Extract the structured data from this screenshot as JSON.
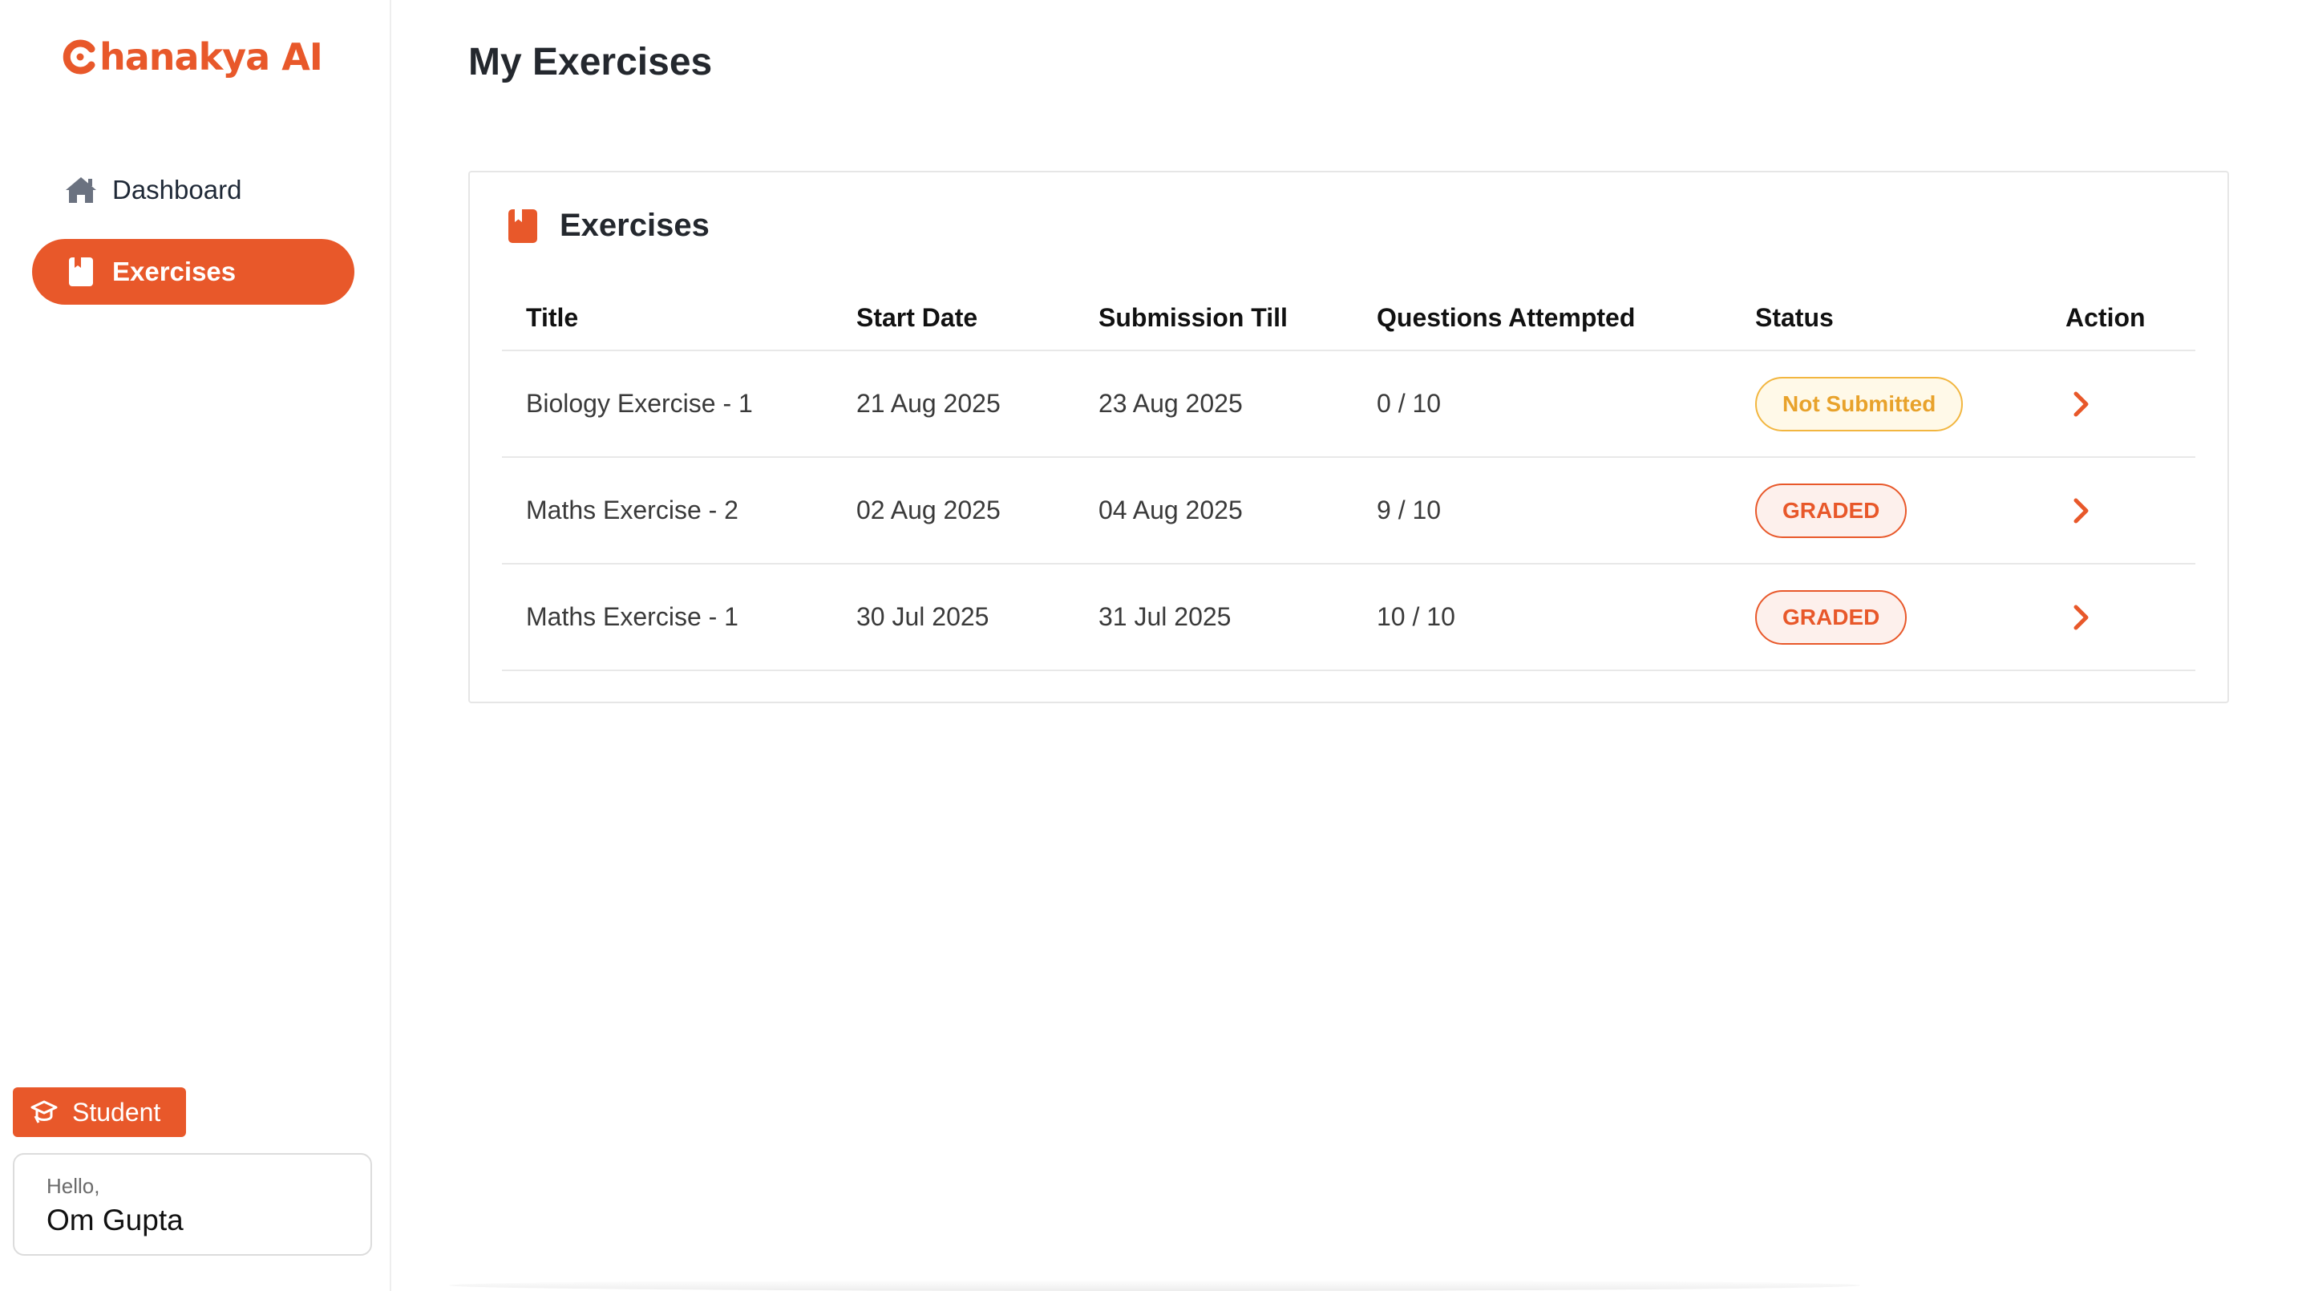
{
  "brand": {
    "logo_text": "hanakya AI",
    "accent": "#e8582a"
  },
  "sidebar": {
    "items": [
      {
        "label": "Dashboard",
        "icon": "home-icon",
        "active": false
      },
      {
        "label": "Exercises",
        "icon": "book-icon",
        "active": true
      }
    ],
    "role": {
      "label": "Student",
      "icon": "graduation-cap-icon"
    },
    "user": {
      "greeting": "Hello,",
      "name": "Om Gupta"
    }
  },
  "main": {
    "page_title": "My Exercises",
    "card": {
      "title": "Exercises",
      "icon": "book-icon",
      "columns": [
        "Title",
        "Start Date",
        "Submission Till",
        "Questions Attempted",
        "Status",
        "Action"
      ],
      "rows": [
        {
          "title": "Biology Exercise - 1",
          "start": "21 Aug 2025",
          "due": "23 Aug 2025",
          "attempted": "0 / 10",
          "status": "Not Submitted",
          "status_kind": "not-submitted"
        },
        {
          "title": "Maths Exercise - 2",
          "start": "02 Aug 2025",
          "due": "04 Aug 2025",
          "attempted": "9 / 10",
          "status": "GRADED",
          "status_kind": "graded"
        },
        {
          "title": "Maths Exercise - 1",
          "start": "30 Jul 2025",
          "due": "31 Jul 2025",
          "attempted": "10 / 10",
          "status": "GRADED",
          "status_kind": "graded"
        }
      ]
    }
  }
}
